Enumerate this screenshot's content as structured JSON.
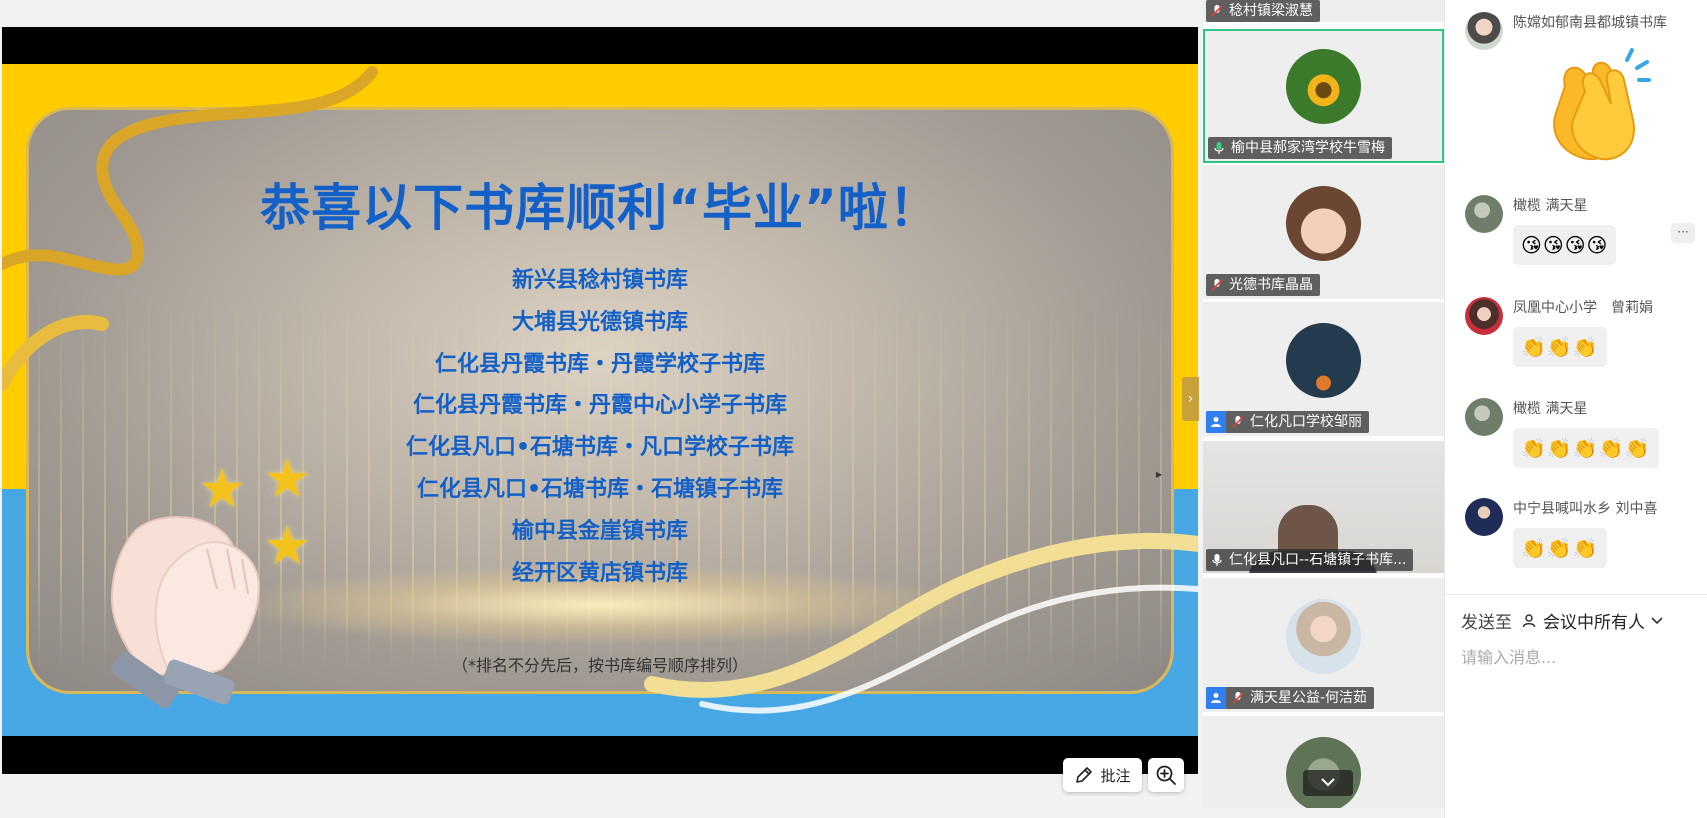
{
  "slide": {
    "title": "恭喜以下书库顺利“毕业”啦！",
    "items": [
      "新兴县稔村镇书库",
      "大埔县光德镇书库",
      "仁化县丹霞书库・丹霞学校子书库",
      "仁化县丹霞书库・丹霞中心小学子书库",
      "仁化县凡口•石塘书库・凡口学校子书库",
      "仁化县凡口•石塘书库・石塘镇子书库",
      "榆中县金崖镇书库",
      "经开区黄店镇书库"
    ],
    "note": "（*排名不分先后，按书库编号顺序排列）"
  },
  "toolbar": {
    "annotate_label": "批注"
  },
  "participants": [
    {
      "name": "稔村镇梁淑慧",
      "mic": "muted",
      "host": false
    },
    {
      "name": "榆中县郝家湾学校牛雪梅",
      "mic": "active",
      "host": false
    },
    {
      "name": "光德书库晶晶",
      "mic": "muted",
      "host": false
    },
    {
      "name": "仁化凡口学校邹丽",
      "mic": "muted",
      "host": true
    },
    {
      "name": "仁化县凡口--石塘镇子书库...",
      "mic": "on",
      "host": false
    },
    {
      "name": "满天星公益-何洁茹",
      "mic": "muted",
      "host": true
    }
  ],
  "chat": {
    "messages": [
      {
        "sender": "陈嫦如郁南县都城镇书库",
        "content": "👏"
      },
      {
        "sender": "橄榄 满天星",
        "content": "😘😘😘😘"
      },
      {
        "sender": "凤凰中心小学　曾莉娟",
        "content": "👏👏👏"
      },
      {
        "sender": "橄榄 满天星",
        "content": "👏👏👏👏👏"
      },
      {
        "sender": "中宁县喊叫水乡 刘中喜",
        "content": "👏👏👏"
      }
    ],
    "more_label": "···",
    "send_to_label": "发送至",
    "send_target": "会议中所有人",
    "input_placeholder": "请输入消息..."
  },
  "colors": {
    "slide_title": "#1361c8",
    "active_speaker_border": "#2ec483",
    "host_badge": "#2f7ff0",
    "muted_icon": "#e0413a"
  }
}
